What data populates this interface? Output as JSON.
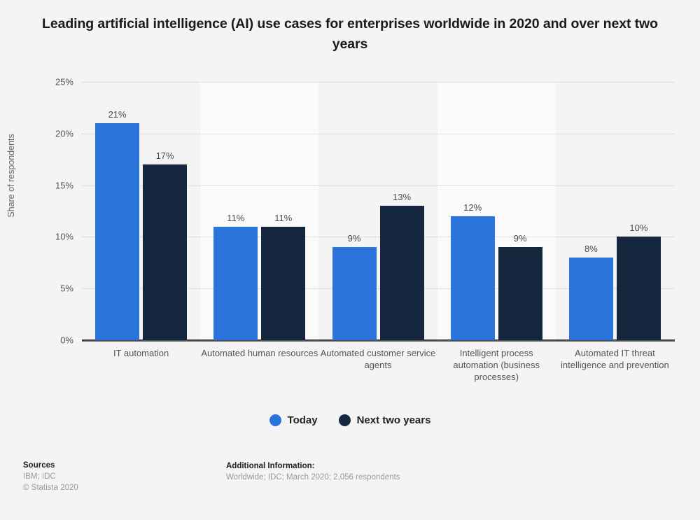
{
  "title": "Leading artificial intelligence (AI) use cases for enterprises worldwide in 2020 and over next two years",
  "legend": {
    "items": [
      {
        "label": "Today",
        "color": "#2a74dc",
        "marker": "circle-marker"
      },
      {
        "label": "Next two years",
        "color": "#14273e",
        "marker": "circle-marker"
      }
    ]
  },
  "footer": {
    "sources_heading": "Sources",
    "sources_value": "IBM; IDC",
    "copyright": "© Statista 2020",
    "additional_heading": "Additional Information:",
    "additional_value": "Worldwide; IDC; March 2020; 2,056 respondents"
  },
  "chart_data": {
    "type": "bar",
    "title": "Leading artificial intelligence (AI) use cases for enterprises worldwide in 2020 and over next two years",
    "xlabel": "",
    "ylabel": "Share of respondents",
    "ylim": [
      0,
      25
    ],
    "ytick_labels": [
      "0%",
      "5%",
      "10%",
      "15%",
      "20%",
      "25%"
    ],
    "ytick_values": [
      0,
      5,
      10,
      15,
      20,
      25
    ],
    "grid": true,
    "legend_position": "bottom",
    "value_suffix": "%",
    "categories": [
      "IT automation",
      "Automated human resources",
      "Automated customer service agents",
      "Intelligent process automation (business processes)",
      "Automated IT threat intelligence and prevention"
    ],
    "series": [
      {
        "name": "Today",
        "color": "#2a74dc",
        "values": [
          21,
          11,
          9,
          12,
          8
        ],
        "labels": [
          "21%",
          "11%",
          "9%",
          "12%",
          "8%"
        ]
      },
      {
        "name": "Next two years",
        "color": "#14273e",
        "values": [
          17,
          11,
          13,
          9,
          10
        ],
        "labels": [
          "17%",
          "11%",
          "13%",
          "9%",
          "10%"
        ]
      }
    ]
  }
}
